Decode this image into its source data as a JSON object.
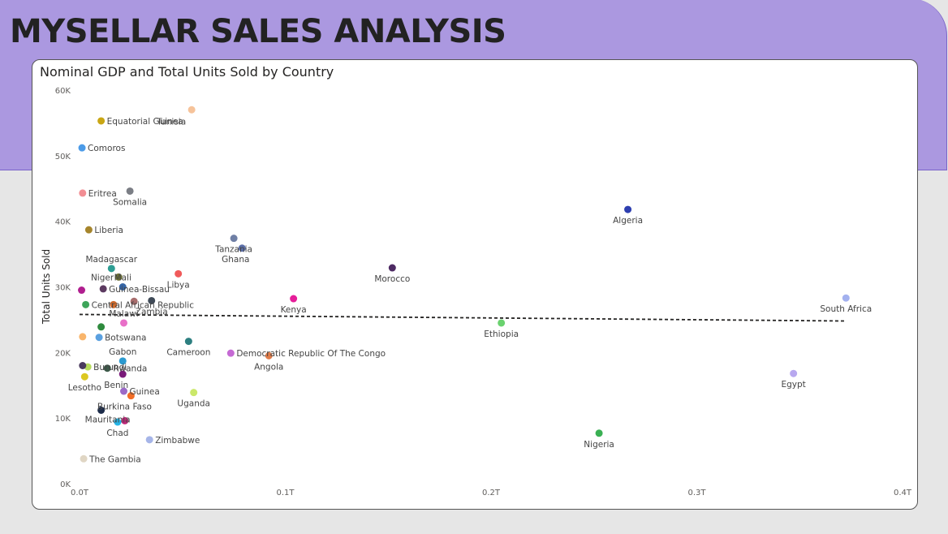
{
  "page": {
    "title": "MYSELLAR SALES ANALYSIS"
  },
  "chart_data": {
    "type": "scatter",
    "title": "Nominal GDP and Total Units Sold by Country",
    "xlabel": "",
    "ylabel": "Total Units Sold",
    "xlim": [
      0,
      0.4
    ],
    "ylim": [
      0,
      60000
    ],
    "x_unit": "T",
    "x_ticks": [
      {
        "value": 0,
        "label": "0.0T"
      },
      {
        "value": 0.1,
        "label": "0.1T"
      },
      {
        "value": 0.2,
        "label": "0.2T"
      },
      {
        "value": 0.3,
        "label": "0.3T"
      },
      {
        "value": 0.4,
        "label": "0.4T"
      }
    ],
    "y_ticks": [
      {
        "value": 0,
        "label": "0K"
      },
      {
        "value": 10000,
        "label": "10K"
      },
      {
        "value": 20000,
        "label": "20K"
      },
      {
        "value": 30000,
        "label": "30K"
      },
      {
        "value": 40000,
        "label": "40K"
      },
      {
        "value": 50000,
        "label": "50K"
      },
      {
        "value": 60000,
        "label": "60K"
      }
    ],
    "trend_line": {
      "x": [
        0,
        0.372
      ],
      "y": [
        25800,
        24800
      ],
      "color": "#252423"
    },
    "points": [
      {
        "name": "Equatorial Guinea",
        "x": 0.0105,
        "y": 55300,
        "color": "#c9a614",
        "label": "right"
      },
      {
        "name": "Tunisia",
        "x": 0.0545,
        "y": 57000,
        "color": "#f6c39a",
        "label": "down-left"
      },
      {
        "name": "Comoros",
        "x": 0.0012,
        "y": 51200,
        "color": "#4b9be8",
        "label": "right"
      },
      {
        "name": "Eritrea",
        "x": 0.0015,
        "y": 44300,
        "color": "#f28e94",
        "label": "right"
      },
      {
        "name": "Somalia",
        "x": 0.0245,
        "y": 44600,
        "color": "#7b7e85",
        "label": "below"
      },
      {
        "name": "Liberia",
        "x": 0.0045,
        "y": 38700,
        "color": "#a6852c",
        "label": "right"
      },
      {
        "name": "Tanzania",
        "x": 0.075,
        "y": 37400,
        "color": "#6f7fa5",
        "label": "below"
      },
      {
        "name": "Ghana",
        "x": 0.079,
        "y": 35900,
        "color": "#5b6ea8",
        "label": "below-left"
      },
      {
        "name": "Algeria",
        "x": 0.2665,
        "y": 41800,
        "color": "#2e3fb0",
        "label": "below"
      },
      {
        "name": "Madagascar",
        "x": 0.0155,
        "y": 32800,
        "color": "#2d9d93",
        "label": "above"
      },
      {
        "name": "Niger",
        "x": 0.019,
        "y": 31500,
        "color": "#6b6f34",
        "label": "left"
      },
      {
        "name": "Mali",
        "x": 0.021,
        "y": 30000,
        "color": "#3565a6",
        "label": "above"
      },
      {
        "name": "Libya",
        "x": 0.048,
        "y": 32000,
        "color": "#f05a5a",
        "label": "below"
      },
      {
        "name": "Guinea-Bissau",
        "x": 0.0115,
        "y": 29700,
        "color": "#5c3a60",
        "label": "right"
      },
      {
        "name": "Morocco",
        "x": 0.152,
        "y": 32900,
        "color": "#4d2a63",
        "label": "below"
      },
      {
        "name": "Kenya",
        "x": 0.104,
        "y": 28200,
        "color": "#e61e9a",
        "label": "below"
      },
      {
        "name": "Central African Republic",
        "x": 0.003,
        "y": 27300,
        "color": "#3ea55a",
        "label": "right"
      },
      {
        "name": "Malawi",
        "x": 0.0215,
        "y": 24500,
        "color": "#e870c8",
        "label": "above"
      },
      {
        "name": "Zambia",
        "x": 0.035,
        "y": 27900,
        "color": "#3f4a57",
        "label": "below"
      },
      {
        "name": "South Africa",
        "x": 0.3725,
        "y": 28300,
        "color": "#a3b1ef",
        "label": "below"
      },
      {
        "name": "Ethiopia",
        "x": 0.205,
        "y": 24500,
        "color": "#6ad26f",
        "label": "below"
      },
      {
        "name": "Botswana",
        "x": 0.0095,
        "y": 22300,
        "color": "#5aa0e0",
        "label": "right"
      },
      {
        "name": "Cameroon",
        "x": 0.053,
        "y": 21700,
        "color": "#2d7f80",
        "label": "below"
      },
      {
        "name": "Democratic Republic Of The Congo",
        "x": 0.0735,
        "y": 19900,
        "color": "#c56ad4",
        "label": "right"
      },
      {
        "name": "Angola",
        "x": 0.092,
        "y": 19500,
        "color": "#e07c4a",
        "label": "below"
      },
      {
        "name": "Gabon",
        "x": 0.021,
        "y": 18700,
        "color": "#2b9ad0",
        "label": "above"
      },
      {
        "name": "Burundi",
        "x": 0.004,
        "y": 17800,
        "color": "#b7dc5c",
        "label": "right"
      },
      {
        "name": "Rwanda",
        "x": 0.0135,
        "y": 17600,
        "color": "#3d5a4a",
        "label": "right"
      },
      {
        "name": "Egypt",
        "x": 0.347,
        "y": 16800,
        "color": "#b8a8ef",
        "label": "below"
      },
      {
        "name": "Lesotho",
        "x": 0.0025,
        "y": 16300,
        "color": "#dcc820",
        "label": "below"
      },
      {
        "name": "Benin",
        "x": 0.021,
        "y": 16700,
        "color": "#7a1a7a",
        "label": "below-left"
      },
      {
        "name": "Guinea",
        "x": 0.0215,
        "y": 14100,
        "color": "#9b6ac7",
        "label": "right"
      },
      {
        "name": "Uganda",
        "x": 0.0555,
        "y": 13900,
        "color": "#cbe86a",
        "label": "below"
      },
      {
        "name": "Burkina Faso",
        "x": 0.025,
        "y": 13400,
        "color": "#f26d26",
        "label": "below-left"
      },
      {
        "name": "Mauritania",
        "x": 0.0105,
        "y": 11200,
        "color": "#1c2c4a",
        "label": "below-right"
      },
      {
        "name": "Chad",
        "x": 0.0185,
        "y": 9400,
        "color": "#24b4e6",
        "label": "below"
      },
      {
        "name": "Zimbabwe",
        "x": 0.034,
        "y": 6700,
        "color": "#a6b5e8",
        "label": "right"
      },
      {
        "name": "Nigeria",
        "x": 0.2525,
        "y": 7700,
        "color": "#3ab053",
        "label": "below"
      },
      {
        "name": "The Gambia",
        "x": 0.002,
        "y": 3800,
        "color": "#e0d6c4",
        "label": "right"
      },
      {
        "name": "",
        "x": 0.0015,
        "y": 22400,
        "color": "#f9b56b",
        "label": "none"
      },
      {
        "name": "",
        "x": 0.0165,
        "y": 27300,
        "color": "#cf6a2c",
        "label": "none"
      },
      {
        "name": "",
        "x": 0.0265,
        "y": 27800,
        "color": "#a86d6d",
        "label": "none"
      },
      {
        "name": "",
        "x": 0.001,
        "y": 29500,
        "color": "#b01e8f",
        "label": "none"
      },
      {
        "name": "",
        "x": 0.0105,
        "y": 23900,
        "color": "#2e8b3e",
        "label": "none"
      },
      {
        "name": "",
        "x": 0.0015,
        "y": 18000,
        "color": "#4a3a5e",
        "label": "none"
      },
      {
        "name": "",
        "x": 0.022,
        "y": 9600,
        "color": "#c0287a",
        "label": "none"
      }
    ]
  }
}
